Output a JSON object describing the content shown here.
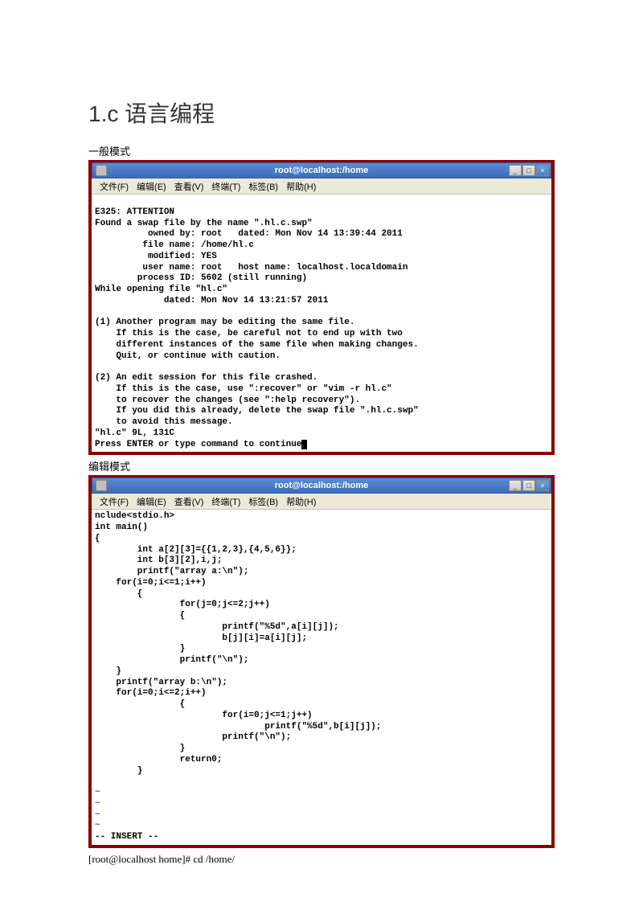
{
  "page": {
    "title": "1.c 语言编程",
    "label_normal": "一般模式",
    "label_edit": "编辑模式"
  },
  "window": {
    "title": "root@localhost:/home"
  },
  "menu": {
    "file": "文件(F)",
    "edit": "编辑(E)",
    "view": "查看(V)",
    "terminal": "终端(T)",
    "tabs": "标签(B)",
    "help": "帮助(H)"
  },
  "titlebar_buttons": {
    "min": "_",
    "max": "□",
    "close": "×"
  },
  "term1": {
    "content": "\nE325: ATTENTION\nFound a swap file by the name \".hl.c.swp\"\n          owned by: root   dated: Mon Nov 14 13:39:44 2011\n         file name: /home/hl.c\n          modified: YES\n         user name: root   host name: localhost.localdomain\n        process ID: 5602 (still running)\nWhile opening file \"hl.c\"\n             dated: Mon Nov 14 13:21:57 2011\n\n(1) Another program may be editing the same file.\n    If this is the case, be careful not to end up with two\n    different instances of the same file when making changes.\n    Quit, or continue with caution.\n\n(2) An edit session for this file crashed.\n    If this is the case, use \":recover\" or \"vim -r hl.c\"\n    to recover the changes (see \":help recovery\").\n    If you did this already, delete the swap file \".hl.c.swp\"\n    to avoid this message.\n\"hl.c\" 9L, 131C\nPress ENTER or type command to continue"
  },
  "term2": {
    "code": "nclude<stdio.h>\nint main()\n{\n        int a[2][3]={{1,2,3},{4,5,6}};\n        int b[3][2],i,j;\n        printf(\"array a:\\n\");\n    for(i=0;i<=1;i++)\n        {\n                for(j=0;j<=2;j++)\n                {\n                        printf(\"%5d\",a[i][j]);\n                        b[j][i]=a[i][j];\n                }\n                printf(\"\\n\");\n    }\n    printf(\"array b:\\n\");\n    for(i=0;i<=2;i++)\n                {\n                        for(i=0;j<=1;j++)\n                                printf(\"%5d\",b[i][j]);\n                        printf(\"\\n\");\n                }\n                return0;\n        }\n",
    "status": "-- INSERT --"
  },
  "tilde": "~",
  "cmdline": "[root@localhost home]# cd /home/"
}
